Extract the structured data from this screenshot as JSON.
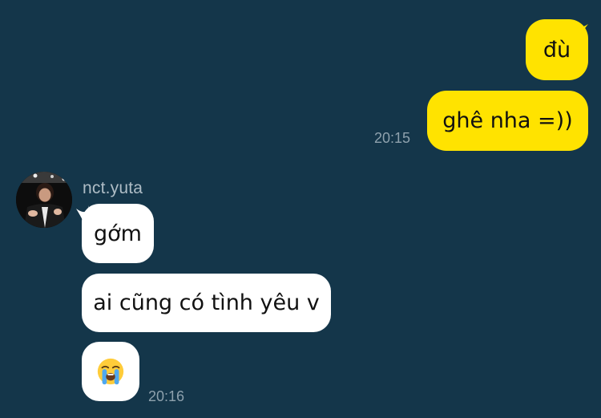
{
  "conversation": {
    "outgoing": [
      {
        "text": "đù"
      },
      {
        "text": "ghê nha =))",
        "time": "20:15"
      }
    ],
    "incoming": {
      "sender": "nct.yuta",
      "messages": [
        {
          "text": "gớm"
        },
        {
          "text": "ai cũng có tình yêu v"
        },
        {
          "emoji": "loudly-crying-face-icon",
          "time": "20:16"
        }
      ]
    }
  },
  "colors": {
    "background": "#14364a",
    "outgoing_bubble": "#ffe300",
    "incoming_bubble": "#ffffff",
    "timestamp": "#8ea1ad",
    "sender_name": "#aebcc5"
  }
}
